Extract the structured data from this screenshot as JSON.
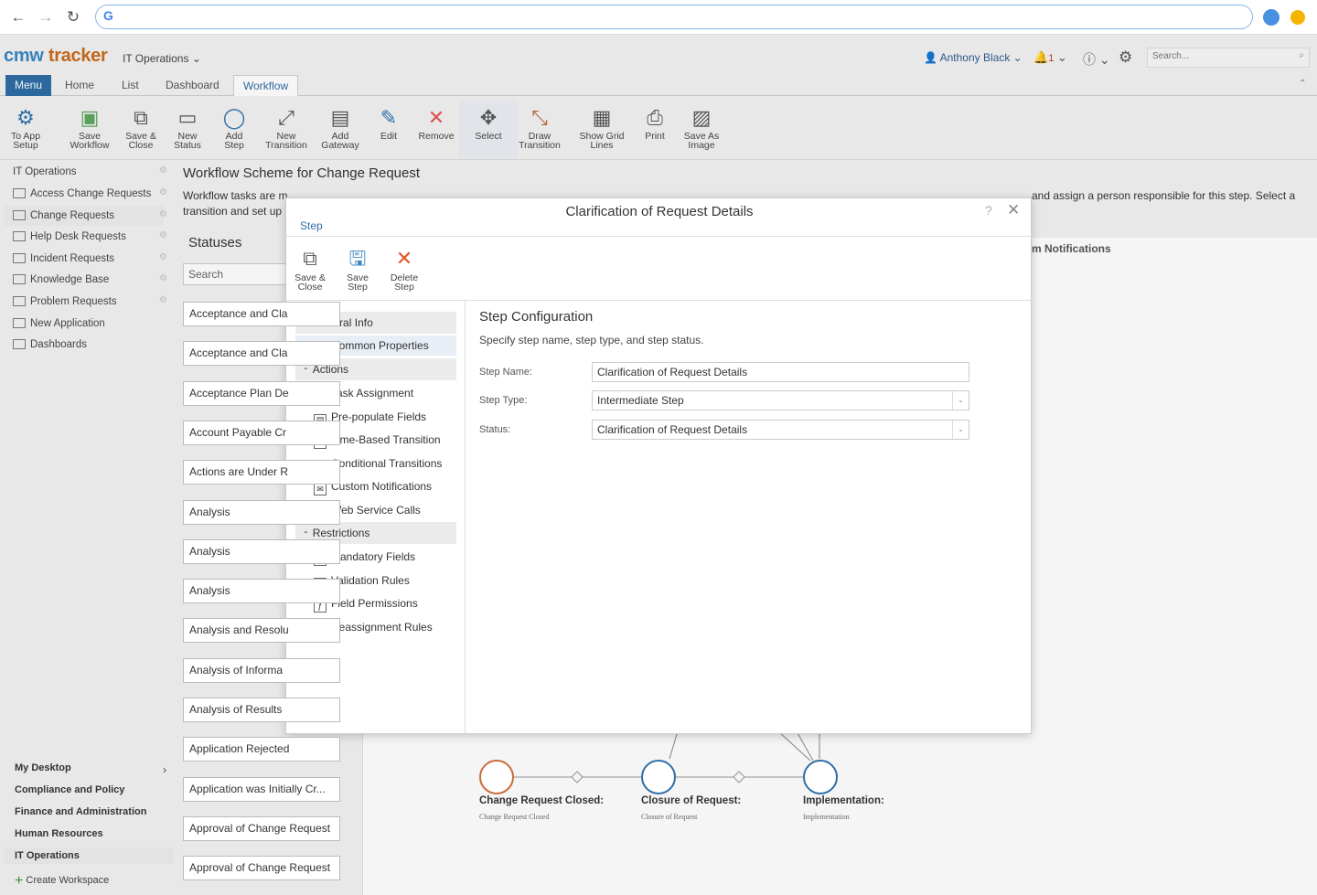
{
  "app": {
    "logo_part1": "cmw",
    "logo_part2": "tracker",
    "workspace": "IT Operations",
    "user": "Anthony Black",
    "notifications": "1",
    "search_placeholder": "Search..."
  },
  "tabs": [
    "Menu",
    "Home",
    "List",
    "Dashboard",
    "Workflow"
  ],
  "toolbar": [
    {
      "line1": "To App",
      "line2": "Setup"
    },
    {
      "line1": "Save",
      "line2": "Workflow"
    },
    {
      "line1": "Save &",
      "line2": "Close"
    },
    {
      "line1": "New",
      "line2": "Status"
    },
    {
      "line1": "Add",
      "line2": "Step"
    },
    {
      "line1": "New",
      "line2": "Transition"
    },
    {
      "line1": "Add",
      "line2": "Gateway"
    },
    {
      "line1": "Edit",
      "line2": ""
    },
    {
      "line1": "Remove",
      "line2": ""
    },
    {
      "line1": "Select",
      "line2": ""
    },
    {
      "line1": "Draw",
      "line2": "Transition"
    },
    {
      "line1": "Show Grid",
      "line2": "Lines"
    },
    {
      "line1": "Print",
      "line2": ""
    },
    {
      "line1": "Save As",
      "line2": "Image"
    }
  ],
  "sidebar": {
    "header": "IT Operations",
    "items": [
      "Access Change Requests",
      "Change Requests",
      "Help Desk Requests",
      "Incident Requests",
      "Knowledge Base",
      "Problem Requests",
      "New Application",
      "Dashboards"
    ],
    "workspaces": [
      "My Desktop",
      "Compliance and Policy",
      "Finance and Administration",
      "Human Resources",
      "IT Operations"
    ],
    "create_workspace": "Create Workspace"
  },
  "main": {
    "title": "Workflow Scheme for Change Request",
    "desc_left": "Workflow tasks are m",
    "desc_right": "and assign a person responsible for this step. Select a",
    "desc_line2": "transition and set up",
    "statuses_heading": "Statuses",
    "search_placeholder": "Search",
    "right_fragment": "m Notifications",
    "statuses": [
      "Acceptance and Cla",
      "Acceptance and Cla",
      "Acceptance Plan De",
      "Account Payable Cr",
      "Actions are Under R",
      "Analysis",
      "Analysis",
      "Analysis",
      "Analysis and Resolu",
      "Analysis of Informa",
      "Analysis of Results",
      "Application Rejected",
      "Application was Initially Cr...",
      "Approval of Change Request",
      "Approval of Change Request"
    ],
    "nodes": [
      {
        "label": "Change Request Closed:",
        "sub": "Change Request Closed",
        "color": "#c96b3c"
      },
      {
        "label": "Closure of Request:",
        "sub": "Closure of Request",
        "color": "#2f6ea6"
      },
      {
        "label": "Implementation:",
        "sub": "Implementation",
        "color": "#2f6ea6"
      }
    ]
  },
  "dialog": {
    "title": "Clarification of Request Details",
    "tab": "Step",
    "help": "?",
    "close": "✕",
    "toolbar": [
      {
        "line1": "Save &",
        "line2": "Close"
      },
      {
        "line1": "Save",
        "line2": "Step"
      },
      {
        "line1": "Delete",
        "line2": "Step"
      }
    ],
    "tree": {
      "general": "General Info",
      "common": "Common Properties",
      "actions": "Actions",
      "action_items": [
        "Task Assignment",
        "Pre-populate Fields",
        "Time-Based Transition",
        "Conditional Transitions",
        "Custom Notifications",
        "Web Service Calls"
      ],
      "restrictions": "Restrictions",
      "restriction_items": [
        "Mandatory Fields",
        "Validation Rules",
        "Field Permissions",
        "Reassignment Rules"
      ]
    },
    "config": {
      "title": "Step Configuration",
      "subtitle": "Specify step name, step type, and step status.",
      "name_label": "Step Name:",
      "name_value": "Clarification of Request Details",
      "type_label": "Step Type:",
      "type_value": "Intermediate Step",
      "status_label": "Status:",
      "status_value": "Clarification of Request Details"
    }
  }
}
